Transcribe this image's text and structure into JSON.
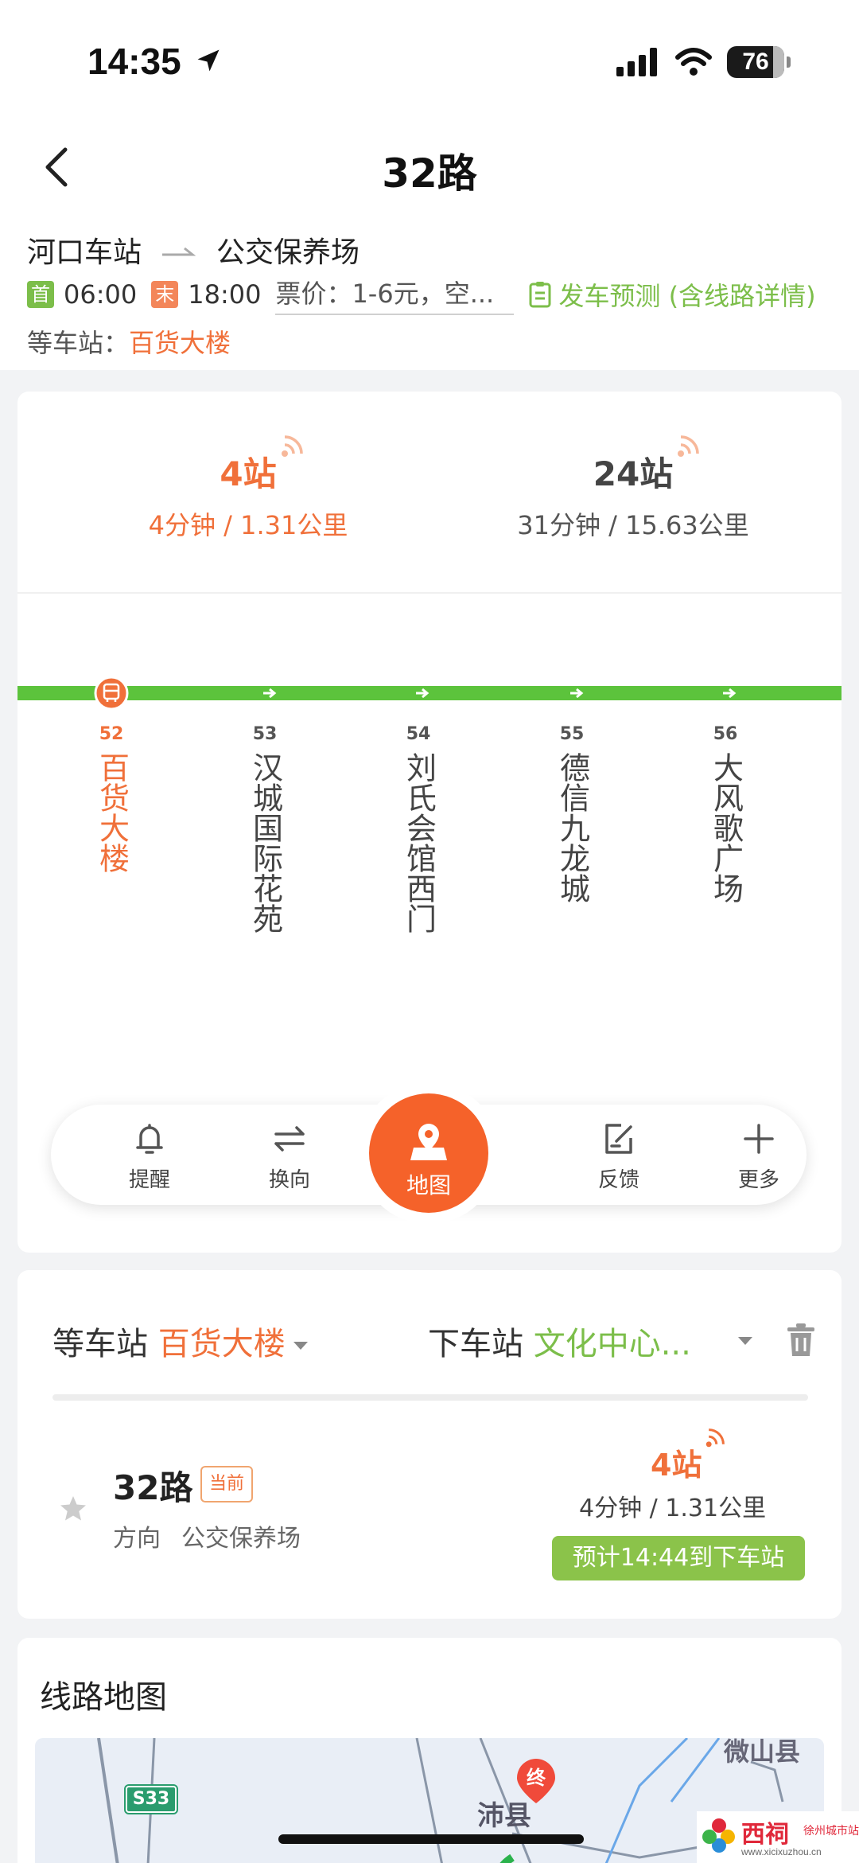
{
  "status_bar": {
    "time": "14:35",
    "battery": "76"
  },
  "header": {
    "title": "32路",
    "from": "河口车站",
    "to": "公交保养场",
    "first_tag": "首",
    "first_time": "06:00",
    "last_tag": "末",
    "last_time": "18:00",
    "fare": "票价：1-6元，空...",
    "forecast": "发车预测 (含线路详情)",
    "wait_label": "等车站：",
    "wait_station": "百货大楼"
  },
  "eta": [
    {
      "stops": "4站",
      "detail": "4分钟 / 1.31公里"
    },
    {
      "stops": "24站",
      "detail": "31分钟 / 15.63公里"
    }
  ],
  "stops": [
    {
      "num": "52",
      "name": "百货大楼",
      "current": true
    },
    {
      "num": "53",
      "name": "汉城国际花苑"
    },
    {
      "num": "54",
      "name": "刘氏会馆西门"
    },
    {
      "num": "55",
      "name": "德信九龙城"
    },
    {
      "num": "56",
      "name": "大风歌广场"
    }
  ],
  "toolbar": {
    "remind": "提醒",
    "switch": "换向",
    "map": "地图",
    "feedback": "反馈",
    "more": "更多"
  },
  "selector": {
    "wait_label": "等车站",
    "wait_value": "百货大楼",
    "off_label": "下车站",
    "off_value": "文化中心..."
  },
  "route_card": {
    "name": "32路",
    "badge": "当前",
    "dir_label": "方向",
    "dir_dest": "公交保养场",
    "stops": "4站",
    "detail": "4分钟 / 1.31公里",
    "arrive": "预计14:44到下车站"
  },
  "map_card": {
    "title": "线路地图",
    "road_sign": "S33",
    "end_marker": "终",
    "label_fengxian": "沛县",
    "label_weishan": "微山县"
  },
  "watermark": {
    "brand": "西祠",
    "sub": "徐州城市站",
    "url": "www.xicixuzhou.cn"
  },
  "colors": {
    "accent_orange": "#f0703a",
    "accent_green": "#7cbe4a",
    "line_green": "#5cc33c",
    "map_button": "#f5622a"
  }
}
